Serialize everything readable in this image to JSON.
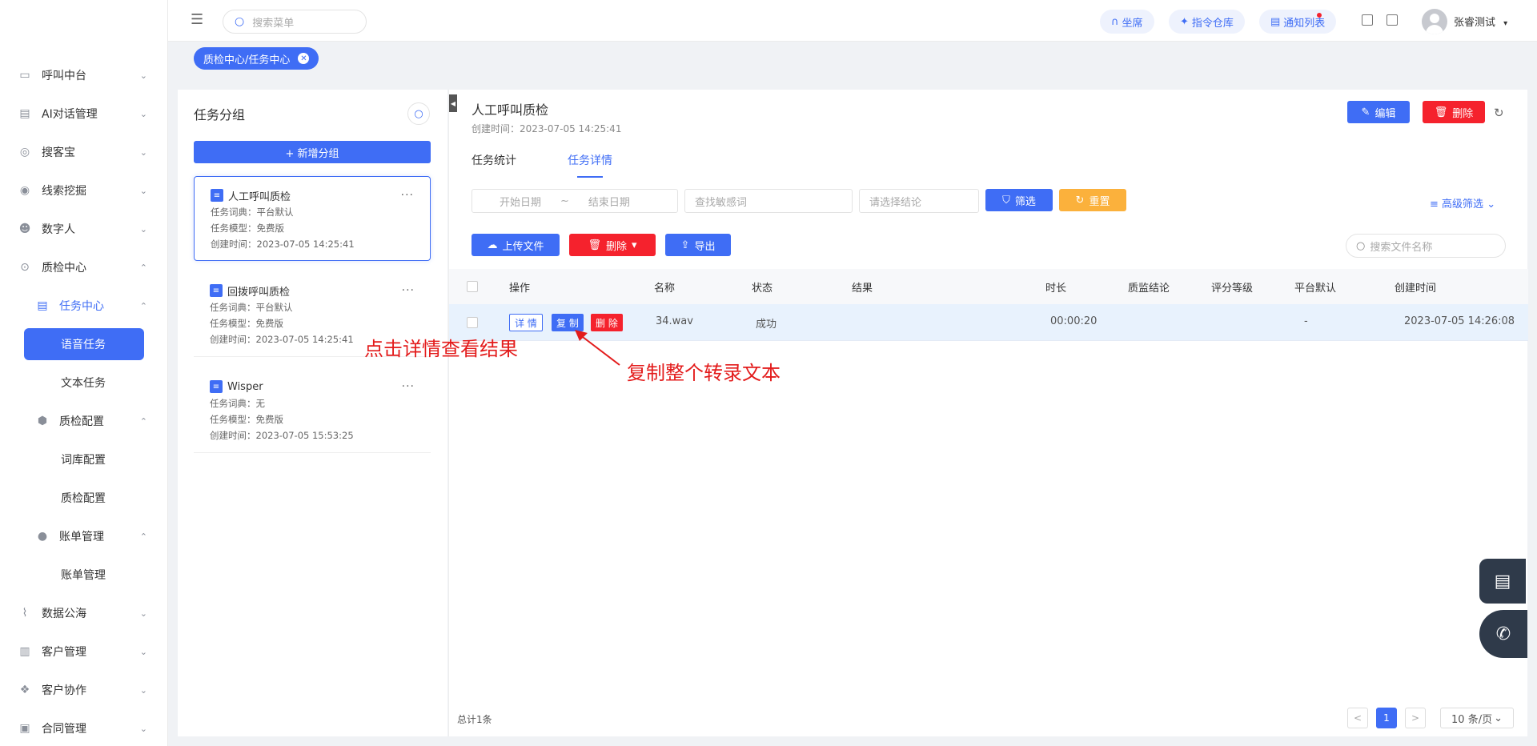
{
  "sidebar": {
    "items": [
      {
        "label": "呼叫中台",
        "icon": "monitor-icon"
      },
      {
        "label": "AI对话管理",
        "icon": "robot-icon"
      },
      {
        "label": "搜客宝",
        "icon": "search-customer-icon"
      },
      {
        "label": "线索挖掘",
        "icon": "target-icon"
      },
      {
        "label": "数字人",
        "icon": "digital-human-icon"
      },
      {
        "label": "质检中心",
        "icon": "quality-check-icon"
      }
    ],
    "quality": {
      "task_center": "任务中心",
      "voice_task": "语音任务",
      "text_task": "文本任务",
      "qc_config": "质检配置",
      "dict_config": "词库配置",
      "qc_config_leaf": "质检配置",
      "billing": "账单管理",
      "billing_leaf": "账单管理"
    },
    "bottom_items": [
      {
        "label": "数据公海",
        "icon": "chart-icon"
      },
      {
        "label": "客户管理",
        "icon": "customer-icon"
      },
      {
        "label": "客户协作",
        "icon": "collaboration-icon"
      },
      {
        "label": "合同管理",
        "icon": "contract-icon"
      }
    ]
  },
  "topbar": {
    "menu_search_placeholder": "搜索菜单",
    "seat": "坐席",
    "command_repo": "指令仓库",
    "notifications": "通知列表",
    "username": "张睿测试"
  },
  "tagbar": {
    "tag": "质检中心/任务中心"
  },
  "groups": {
    "title": "任务分组",
    "add_button": "+ 新增分组",
    "items": [
      {
        "name": "人工呼叫质检",
        "dict": "任务词典：平台默认",
        "model": "任务模型：免费版",
        "created": "创建时间：2023-07-05 14:25:41"
      },
      {
        "name": "回拨呼叫质检",
        "dict": "任务词典：平台默认",
        "model": "任务模型：免费版",
        "created": "创建时间：2023-07-05 14:25:41"
      },
      {
        "name": "Wisper",
        "dict": "任务词典：无",
        "model": "任务模型：免费版",
        "created": "创建时间：2023-07-05 15:53:25"
      }
    ]
  },
  "main": {
    "title": "人工呼叫质检",
    "created": "创建时间：2023-07-05 14:25:41",
    "edit_button": "编辑",
    "delete_button": "删除",
    "tabs": [
      "任务统计",
      "任务详情"
    ],
    "filters": {
      "start_date": "开始日期",
      "tilde": "~",
      "end_date": "结束日期",
      "keyword_placeholder": "查找敏感词",
      "conclusion_placeholder": "请选择结论",
      "filter_button": "筛选",
      "reset_button": "重置",
      "advanced": "高级筛选"
    },
    "actions": {
      "upload": "上传文件",
      "delete": "删除",
      "export": "导出",
      "file_search_placeholder": "搜索文件名称"
    },
    "table": {
      "headers": [
        "操作",
        "名称",
        "状态",
        "结果",
        "时长",
        "质监结论",
        "评分等级",
        "平台默认",
        "创建时间"
      ],
      "rows": [
        {
          "detail": "详 情",
          "copy": "复 制",
          "remove": "删 除",
          "name": "34.wav",
          "status": "成功",
          "result": "",
          "duration": "00:00:20",
          "conclusion": "",
          "grade": "",
          "platform_default": "-",
          "created": "2023-07-05 14:26:08"
        }
      ]
    },
    "footer": {
      "total": "总计1条",
      "prev": "<",
      "page": "1",
      "next": ">",
      "page_size": "10 条/页"
    }
  },
  "annotations": {
    "detail_hint": "点击详情查看结果",
    "copy_hint": "复制整个转录文本"
  },
  "colors": {
    "primary": "#3f6df5",
    "danger": "#f5222d",
    "warning": "#fbb13c",
    "annotation": "#e31b1b"
  }
}
